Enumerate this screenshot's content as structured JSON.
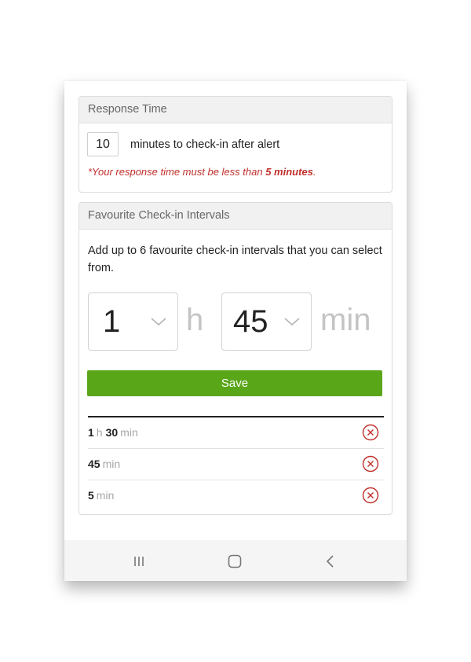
{
  "response_time": {
    "header": "Response Time",
    "value": "10",
    "label": "minutes to check-in after alert",
    "warning_prefix": "*Your response time must be less than ",
    "warning_bold": "5 minutes",
    "warning_suffix": "."
  },
  "favourites": {
    "header": "Favourite Check-in Intervals",
    "description": "Add up to 6 favourite check-in intervals that you can select from.",
    "hours_picker": {
      "value": "1",
      "unit": "h"
    },
    "minutes_picker": {
      "value": "45",
      "unit": "min"
    },
    "save_label": "Save",
    "intervals": [
      {
        "hours": "1",
        "hours_unit": "h",
        "minutes": "30",
        "minutes_unit": "min"
      },
      {
        "minutes": "45",
        "minutes_unit": "min"
      },
      {
        "minutes": "5",
        "minutes_unit": "min"
      }
    ]
  },
  "icons": {
    "chevron": "chevron-down-icon",
    "remove": "remove-circle-icon",
    "nav_recent": "recent-apps-icon",
    "nav_home": "home-icon",
    "nav_back": "back-icon"
  },
  "colors": {
    "accent": "#5aa619",
    "warning": "#c0302b",
    "remove": "#c0302b",
    "muted": "#a6a6a6"
  }
}
